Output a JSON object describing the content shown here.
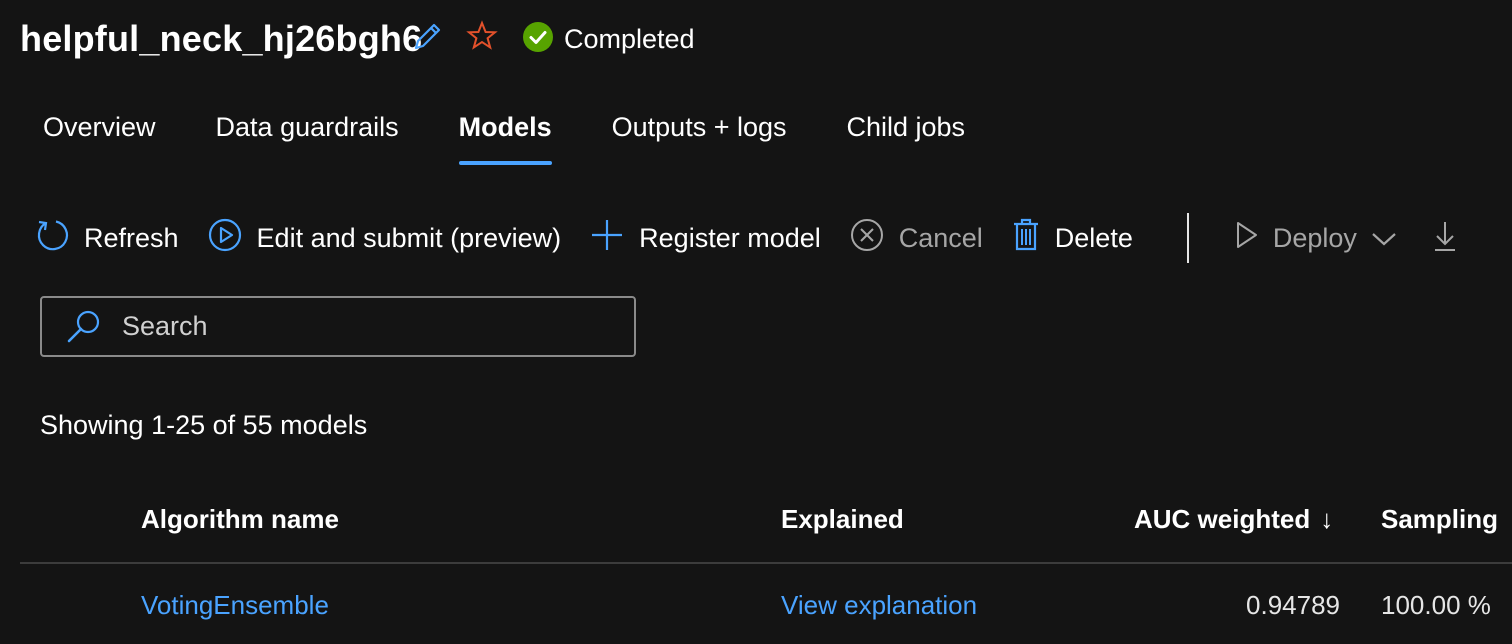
{
  "header": {
    "title": "helpful_neck_hj26bgh6",
    "status": "Completed",
    "colors": {
      "status_ok": "#57a300",
      "accent": "#4aa3ff",
      "star": "#e3512b"
    }
  },
  "tabs": [
    {
      "label": "Overview"
    },
    {
      "label": "Data guardrails"
    },
    {
      "label": "Models",
      "active": true
    },
    {
      "label": "Outputs + logs"
    },
    {
      "label": "Child jobs"
    }
  ],
  "toolbar": {
    "refresh": "Refresh",
    "edit_submit": "Edit and submit (preview)",
    "register_model": "Register model",
    "cancel": "Cancel",
    "delete": "Delete",
    "deploy": "Deploy"
  },
  "search": {
    "placeholder": "Search"
  },
  "summary": "Showing 1-25 of 55 models",
  "table": {
    "columns": [
      "Algorithm name",
      "Explained",
      "AUC weighted",
      "Sampling"
    ],
    "sort_indicator": "↓",
    "rows": [
      {
        "algorithm": "VotingEnsemble",
        "explained": "View explanation",
        "auc": "0.94789",
        "sampling": "100.00 %"
      }
    ]
  }
}
